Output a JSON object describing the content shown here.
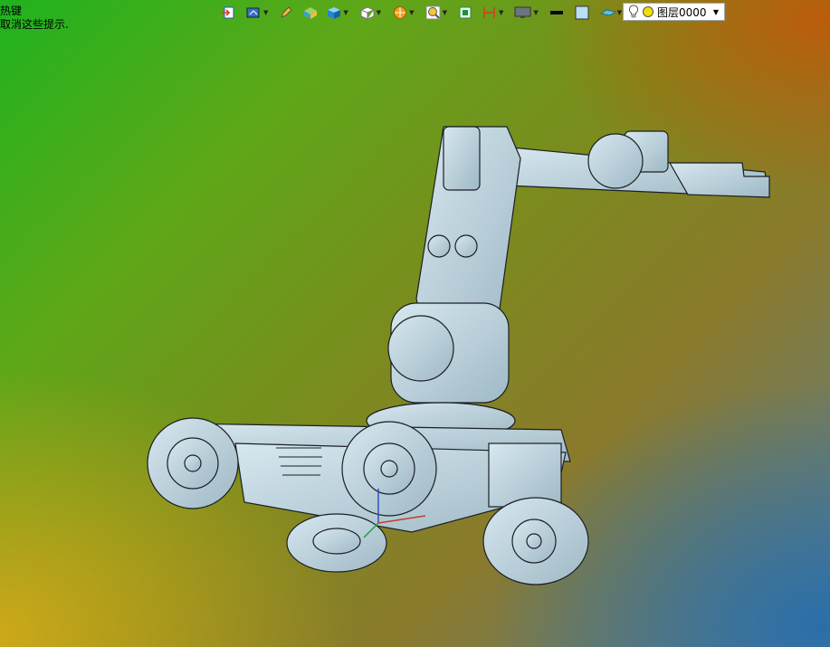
{
  "hint": {
    "line1": "热键",
    "line2": "取消这些提示."
  },
  "toolbar": {
    "items": [
      {
        "name": "exit-icon"
      },
      {
        "name": "view-orient-icon"
      },
      {
        "name": "pencil-icon"
      },
      {
        "name": "shaded-box-icon"
      },
      {
        "name": "solid-cube-icon"
      },
      {
        "name": "wire-cube-icon"
      },
      {
        "name": "render-sphere-icon"
      },
      {
        "name": "zoom-icon"
      },
      {
        "name": "fit-view-icon"
      },
      {
        "name": "dimension-icon"
      },
      {
        "name": "monitor-icon"
      },
      {
        "name": "line-color-icon"
      },
      {
        "name": "fill-color-icon"
      },
      {
        "name": "plane-icon"
      }
    ],
    "layer": {
      "label": "图层0000",
      "bulb_color": "#f5d800",
      "dot_color": "#f0e000"
    }
  },
  "colors": {
    "part": "#b9d2dd",
    "edge": "#1a1f24"
  }
}
